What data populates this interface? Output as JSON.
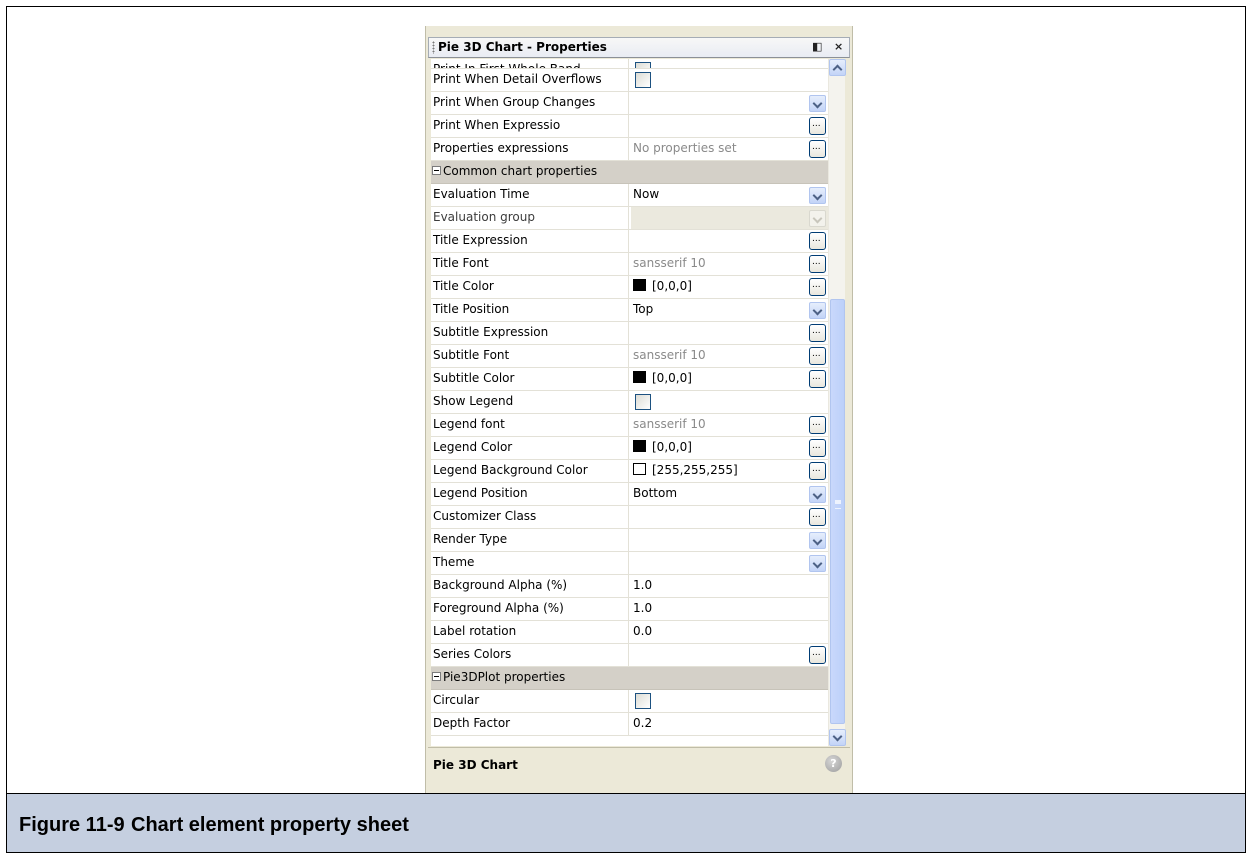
{
  "window": {
    "title": "Pie 3D Chart - Properties",
    "pin_glyph": "◧",
    "close_glyph": "×"
  },
  "rows": [
    {
      "type": "row",
      "name": "Print In First Whole Band",
      "editor": "checkbox",
      "partial": true
    },
    {
      "type": "row",
      "name": "Print When Detail Overflows",
      "editor": "checkbox"
    },
    {
      "type": "row",
      "name": "Print When Group Changes",
      "value": "",
      "editor": "dropdown"
    },
    {
      "type": "row",
      "name": "Print When Expressio",
      "value": "",
      "editor": "ellipsis"
    },
    {
      "type": "row",
      "name": "Properties expressions",
      "value": "No properties set",
      "grey": true,
      "editor": "ellipsis"
    },
    {
      "type": "category",
      "name": "Common chart properties"
    },
    {
      "type": "row",
      "name": "Evaluation Time",
      "value": "Now",
      "editor": "dropdown"
    },
    {
      "type": "row",
      "name": "Evaluation group",
      "value": "",
      "editor": "dropdown",
      "disabled": true
    },
    {
      "type": "row",
      "name": "Title Expression",
      "value": "",
      "editor": "ellipsis"
    },
    {
      "type": "row",
      "name": "Title Font",
      "value": "sansserif 10",
      "grey": true,
      "editor": "ellipsis"
    },
    {
      "type": "row",
      "name": "Title Color",
      "value": "[0,0,0]",
      "swatch": "#000000",
      "editor": "ellipsis"
    },
    {
      "type": "row",
      "name": "Title Position",
      "value": "Top",
      "editor": "dropdown"
    },
    {
      "type": "row",
      "name": "Subtitle Expression",
      "value": "",
      "editor": "ellipsis"
    },
    {
      "type": "row",
      "name": "Subtitle Font",
      "value": "sansserif 10",
      "grey": true,
      "editor": "ellipsis"
    },
    {
      "type": "row",
      "name": "Subtitle Color",
      "value": "[0,0,0]",
      "swatch": "#000000",
      "editor": "ellipsis"
    },
    {
      "type": "row",
      "name": "Show Legend",
      "editor": "checkbox"
    },
    {
      "type": "row",
      "name": "Legend font",
      "value": "sansserif 10",
      "grey": true,
      "editor": "ellipsis"
    },
    {
      "type": "row",
      "name": "Legend Color",
      "value": "[0,0,0]",
      "swatch": "#000000",
      "editor": "ellipsis"
    },
    {
      "type": "row",
      "name": "Legend Background Color",
      "value": "[255,255,255]",
      "swatch": "#ffffff",
      "editor": "ellipsis"
    },
    {
      "type": "row",
      "name": "Legend Position",
      "value": "Bottom",
      "editor": "dropdown"
    },
    {
      "type": "row",
      "name": "Customizer Class",
      "value": "",
      "editor": "ellipsis"
    },
    {
      "type": "row",
      "name": "Render Type",
      "value": "",
      "editor": "dropdown"
    },
    {
      "type": "row",
      "name": "Theme",
      "value": "",
      "editor": "dropdown"
    },
    {
      "type": "row",
      "name": "Background Alpha (%)",
      "value": "1.0",
      "editor": "text"
    },
    {
      "type": "row",
      "name": "Foreground Alpha (%)",
      "value": "1.0",
      "editor": "text"
    },
    {
      "type": "row",
      "name": "Label rotation",
      "value": "0.0",
      "editor": "text"
    },
    {
      "type": "row",
      "name": "Series Colors",
      "value": "",
      "editor": "ellipsis"
    },
    {
      "type": "category",
      "name": "Pie3DPlot properties"
    },
    {
      "type": "row",
      "name": "Circular",
      "editor": "checkbox"
    },
    {
      "type": "row",
      "name": "Depth Factor",
      "value": "0.2",
      "editor": "text"
    }
  ],
  "description": {
    "title": "Pie 3D Chart",
    "help_glyph": "?"
  },
  "caption": {
    "number": "Figure 11-9",
    "text": "Chart element property sheet"
  },
  "colors": {
    "panel_bg": "#ece9d8",
    "category_bg": "#d4d0c8",
    "caption_bg": "#c5cfe0",
    "scroll_accent": "#c3d4f7"
  },
  "scroll": {
    "position_fraction": 0.35,
    "visible_fraction": 0.62
  }
}
